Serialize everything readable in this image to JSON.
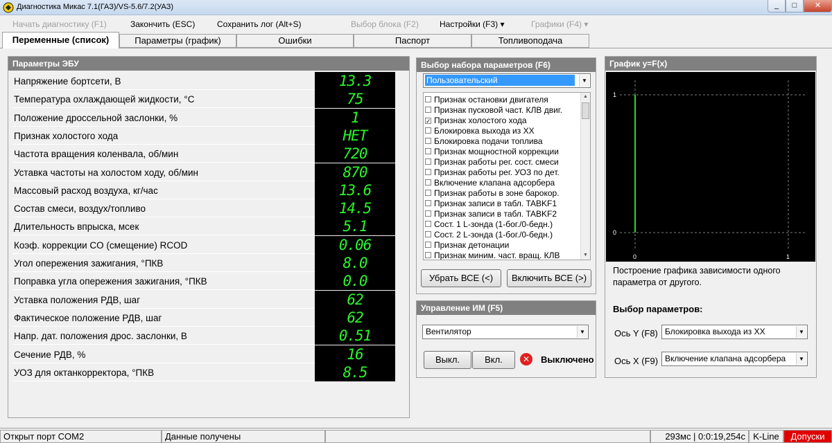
{
  "window": {
    "title": "Диагностика Микас 7.1(ГАЗ)/VS-5.6/7.2(УАЗ)",
    "min_symbol": "_",
    "max_symbol": "□",
    "close_symbol": "✕"
  },
  "menu": [
    {
      "label": "Начать диагностику (F1)",
      "enabled": false
    },
    {
      "label": "Закончить (ESC)",
      "enabled": true
    },
    {
      "label": "Сохранить лог (Alt+S)",
      "enabled": true
    },
    {
      "label": "Выбор блока (F2)",
      "enabled": false
    },
    {
      "label": "Настройки (F3) ▾",
      "enabled": true
    },
    {
      "label": "Графики (F4) ▾",
      "enabled": false
    }
  ],
  "tabs": [
    {
      "label": "Переменные (список)",
      "active": true
    },
    {
      "label": "Параметры (график)",
      "active": false
    },
    {
      "label": "Ошибки",
      "active": false
    },
    {
      "label": "Паспорт",
      "active": false
    },
    {
      "label": "Топливоподача",
      "active": false
    }
  ],
  "ecu_panel": {
    "title": "Параметры ЭБУ",
    "params": [
      {
        "label": "Напряжение бортсети, В",
        "value": "13.3"
      },
      {
        "label": "Температура охлаждающей жидкости, °С",
        "value": "75"
      },
      {
        "label": "Положение дроссельной заслонки, %",
        "value": "1"
      },
      {
        "label": "Признак холостого хода",
        "value": "НЕТ"
      },
      {
        "label": "Частота вращения коленвала, об/мин",
        "value": "720"
      },
      {
        "label": "Уставка частоты на холостом ходу, об/мин",
        "value": "870"
      },
      {
        "label": "Массовый расход  воздуха, кг/час",
        "value": "13.6"
      },
      {
        "label": "Состав смеси, воздух/топливо",
        "value": "14.5"
      },
      {
        "label": "Длительность впрыска, мсек",
        "value": "5.1"
      },
      {
        "label": "Коэф. коррекции CO (смещение) RCOD",
        "value": "0.06"
      },
      {
        "label": "Угол опережения зажигания, °ПКВ",
        "value": "8.0"
      },
      {
        "label": "Поправка угла опережения зажигания, °ПКВ",
        "value": "0.0"
      },
      {
        "label": "Уставка положения РДВ, шаг",
        "value": "62"
      },
      {
        "label": "Фактическое положение РДВ, шаг",
        "value": "62"
      },
      {
        "label": "Напр. дат. положения дрос. заслонки, В",
        "value": "0.51"
      },
      {
        "label": "Сечение РДВ, %",
        "value": "16"
      },
      {
        "label": "УОЗ для октанкорректора, °ПКВ",
        "value": "8.5"
      }
    ]
  },
  "param_set": {
    "title": "Выбор набора параметров (F6)",
    "selected": "Пользовательский",
    "items": [
      {
        "label": "Признак остановки двигателя",
        "checked": false
      },
      {
        "label": "Признак пусковой част. КЛВ двиг.",
        "checked": false
      },
      {
        "label": "Признак холостого хода",
        "checked": true
      },
      {
        "label": "Блокировка выхода из ХХ",
        "checked": false
      },
      {
        "label": "Блокировка подачи топлива",
        "checked": false
      },
      {
        "label": "Признак мощностной коррекции",
        "checked": false
      },
      {
        "label": "Признак работы рег. сост. смеси",
        "checked": false
      },
      {
        "label": "Признак работы рег. УОЗ по дет.",
        "checked": false
      },
      {
        "label": "Включение клапана адсорбера",
        "checked": false
      },
      {
        "label": "Признак работы в зоне барокор.",
        "checked": false
      },
      {
        "label": "Признак записи в табл. TABKF1",
        "checked": false
      },
      {
        "label": "Признак записи в табл. TABKF2",
        "checked": false
      },
      {
        "label": "Сост. 1 L-зонда (1-бог./0-бедн.)",
        "checked": false
      },
      {
        "label": "Сост. 2 L-зонда (1-бог./0-бедн.)",
        "checked": false
      },
      {
        "label": "Признак детонации",
        "checked": false
      },
      {
        "label": "Признак миним. част. вращ. КЛВ",
        "checked": false
      }
    ],
    "clear_all": "Убрать ВСЕ (<)",
    "include_all": "Включить ВСЕ (>)"
  },
  "actuator": {
    "title": "Управление ИМ (F5)",
    "selected": "Вентилятор",
    "off_button": "Выкл.",
    "on_button": "Вкл.",
    "state": "Выключено"
  },
  "graph": {
    "title": "График y=F(x)",
    "caption": "Построение графика зависимости одного параметра от другого.",
    "params_title": "Выбор параметров:",
    "y_axis_label": "Ось Y (F8)",
    "y_axis_value": "Блокировка выхода из ХХ",
    "x_axis_label": "Ось X (F9)",
    "x_axis_value": "Включение клапана адсорбера",
    "x_ticks": [
      "0",
      "1"
    ],
    "y_ticks": [
      "1",
      "0"
    ],
    "trace_color": "#22dd22",
    "grid_color": "#808080"
  },
  "status": {
    "port": "Открыт порт COM2",
    "data": "Данные получены",
    "timing": "293мс | 0:0:19,254с",
    "protocol": "K-Line",
    "tolerances": "Допуски"
  },
  "colors": {
    "value_green": "#2bf52b",
    "panel_header": "#808080",
    "selection_blue": "#3399ff",
    "alert_red": "#e00000"
  }
}
